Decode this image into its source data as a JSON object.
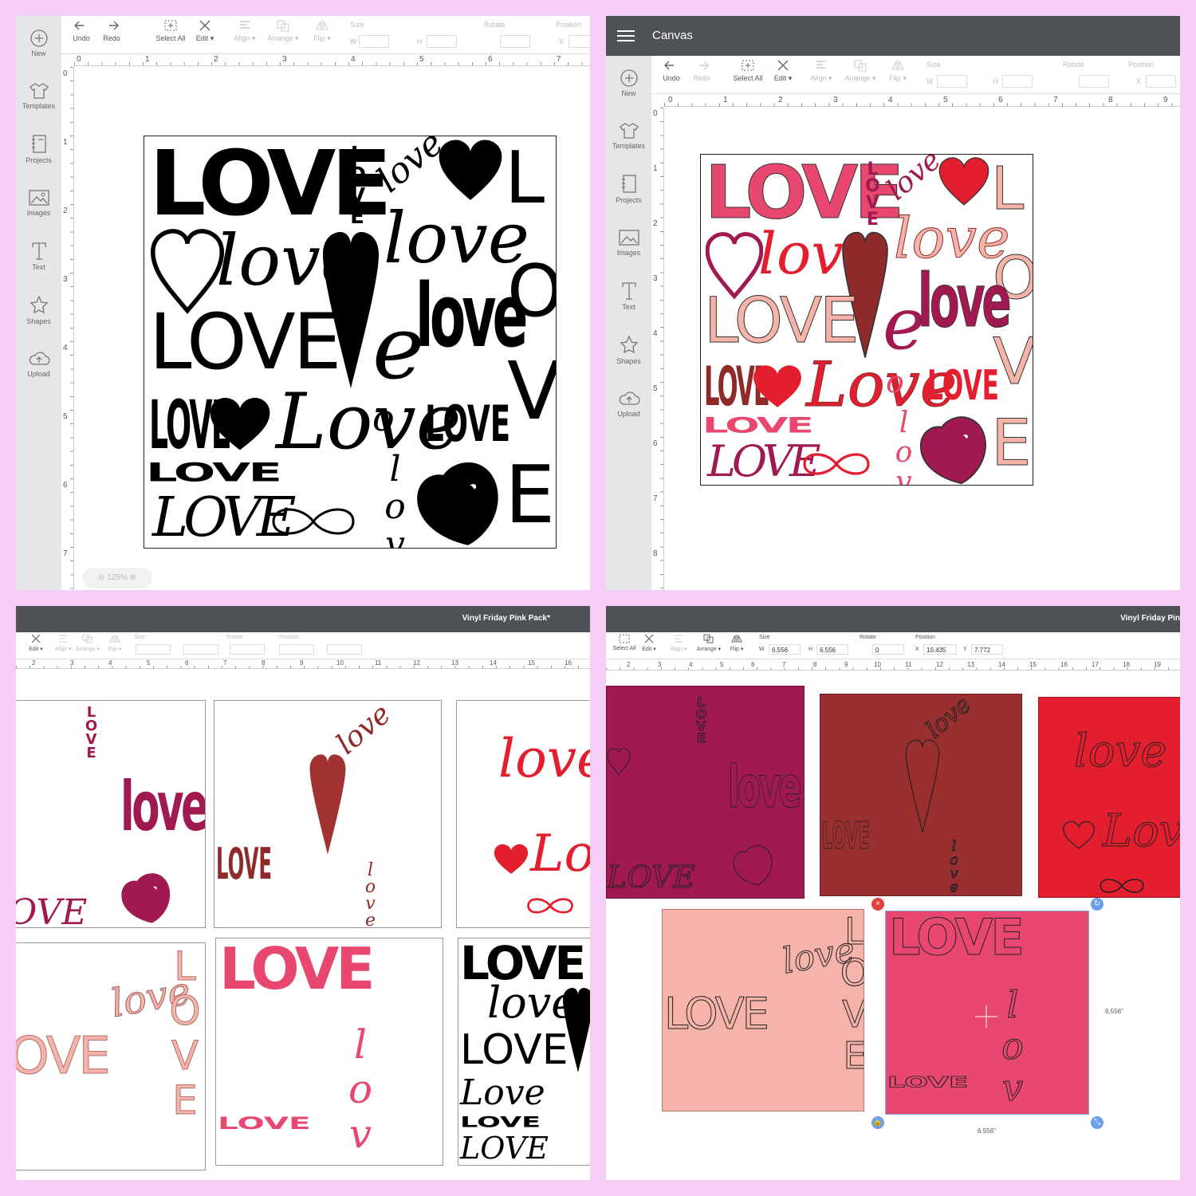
{
  "sidebar": {
    "new": "New",
    "templates": "Templates",
    "projects": "Projects",
    "images": "Images",
    "text": "Text",
    "shapes": "Shapes",
    "upload": "Upload"
  },
  "toolbar": {
    "undo": "Undo",
    "redo": "Redo",
    "select_all": "Select All",
    "edit": "Edit",
    "align": "Align",
    "arrange": "Arrange",
    "flip": "Flip",
    "size": "Size",
    "rotate": "Rotate",
    "position": "Position",
    "w": "W",
    "h": "H",
    "x": "X",
    "y": "Y"
  },
  "panel1": {
    "zoom": "125%",
    "ruler_h": [
      "0",
      "1",
      "2",
      "3",
      "4",
      "5",
      "6",
      "7"
    ],
    "ruler_v": [
      "0",
      "1",
      "2",
      "3",
      "4",
      "5",
      "6",
      "7"
    ]
  },
  "panel2": {
    "title": "Canvas",
    "ruler_h": [
      "0",
      "1",
      "2",
      "3",
      "4",
      "5",
      "6",
      "7",
      "8",
      "9"
    ],
    "ruler_v": [
      "0",
      "1",
      "2",
      "3",
      "4",
      "5",
      "6",
      "7",
      "8"
    ]
  },
  "panel3": {
    "title": "Vinyl Friday Pink Pack*",
    "ruler_h": [
      "2",
      "3",
      "4",
      "5",
      "6",
      "7",
      "8",
      "9",
      "10",
      "11",
      "12",
      "13",
      "14",
      "15",
      "16"
    ]
  },
  "panel4": {
    "title": "Vinyl Friday Pin",
    "w_value": "6.556",
    "h_value": "6.556",
    "rotate_value": "0",
    "x_value": "10.435",
    "y_value": "7.772",
    "dim_side": "6.556\"",
    "dim_bottom": "6.556\"",
    "ruler_h": [
      "2",
      "3",
      "4",
      "5",
      "6",
      "7",
      "8",
      "9",
      "10",
      "11",
      "12",
      "13",
      "14",
      "15",
      "16",
      "17",
      "18",
      "19"
    ]
  },
  "words": {
    "love_upper": "LOVE",
    "love_cap": "Love",
    "love_lower": "love",
    "letter_l": "L",
    "letter_o": "O",
    "letter_v": "V",
    "letter_e": "E",
    "love_vertical": "love",
    "e_letter": "e",
    "o_letter": "o"
  },
  "colors": {
    "background": "#f6cdf4",
    "titlebar": "#4e5155",
    "wine": "#a01950",
    "maroon": "#8e2a2a",
    "red": "#e31e2f",
    "peach": "#f5b3a9",
    "pink": "#e8476f",
    "black": "#000000"
  }
}
